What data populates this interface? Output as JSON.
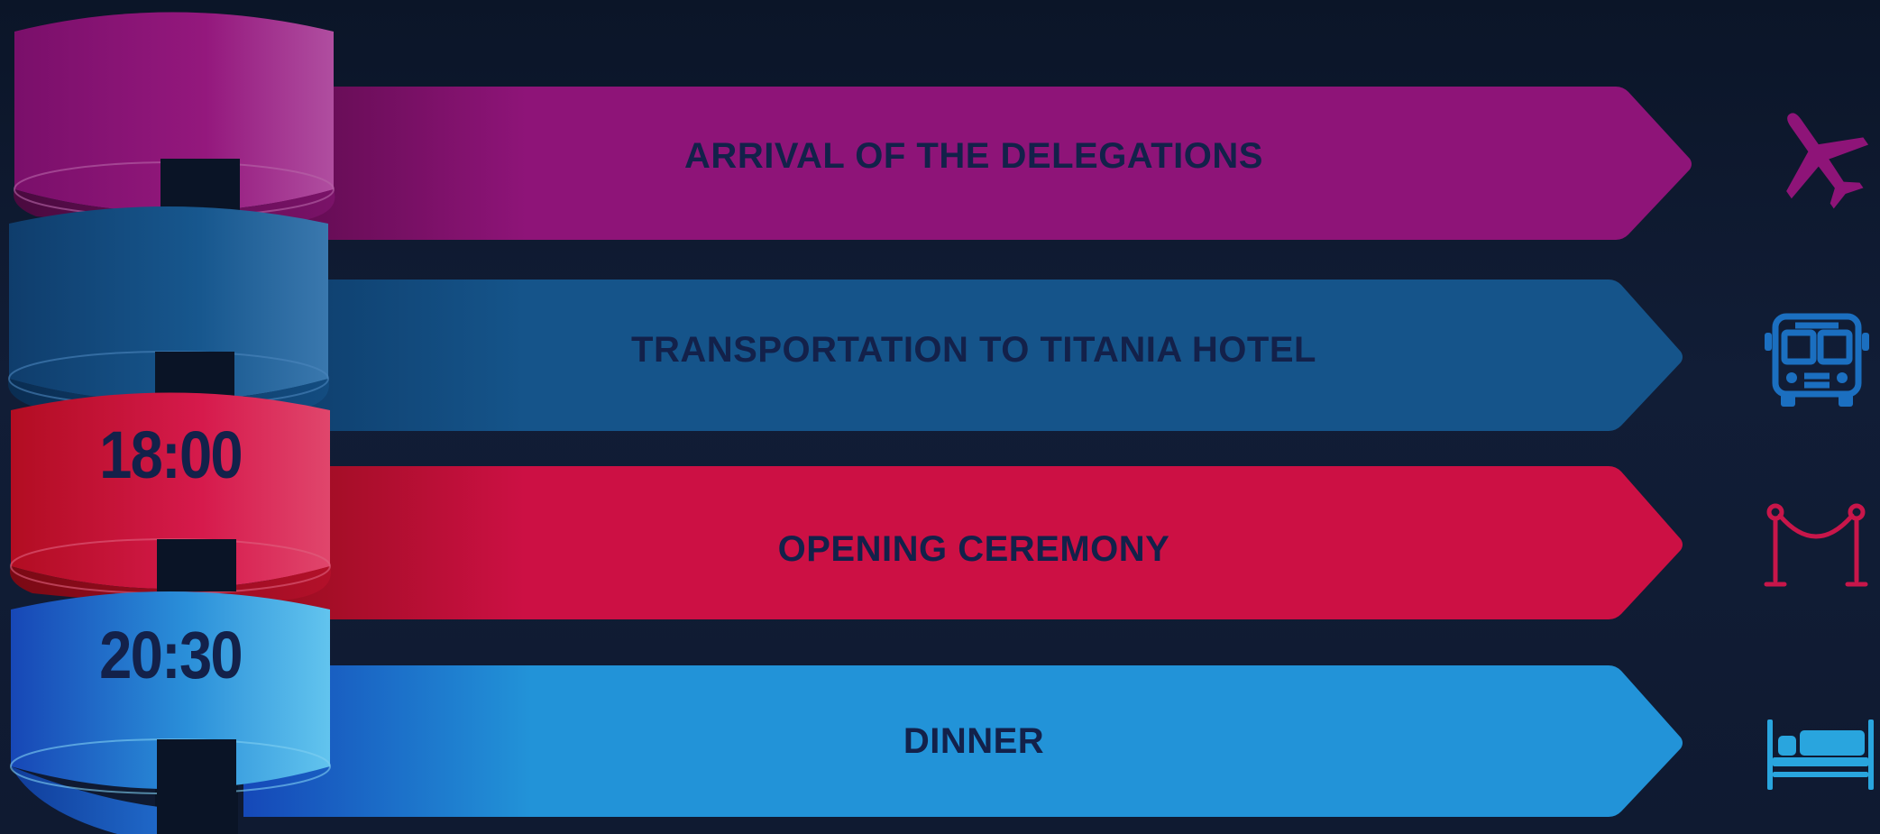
{
  "items": [
    {
      "title": "ARRIVAL OF THE DELEGATIONS",
      "time": "",
      "icon": "airplane-icon",
      "color": "#8e1478"
    },
    {
      "title": "TRANSPORTATION TO TITANIA HOTEL",
      "time": "",
      "icon": "bus-icon",
      "color": "#15548a"
    },
    {
      "title": "OPENING CEREMONY",
      "time": "18:00",
      "icon": "rope-barrier-icon",
      "color": "#cc1044"
    },
    {
      "title": "DINNER",
      "time": "20:30",
      "icon": "bed-icon",
      "color": "#2293d8"
    }
  ],
  "colors": {
    "background": "#0f1a31",
    "text": "#13214a",
    "airplane_icon": "#8e1478",
    "bus_icon": "#1b6fc0",
    "barrier_icon": "#c8164a",
    "bed_icon": "#29a5de"
  }
}
